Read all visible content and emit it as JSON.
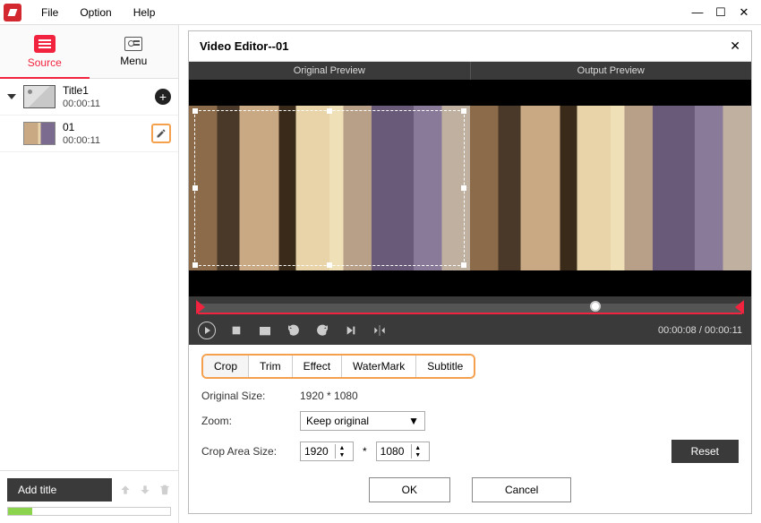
{
  "menubar": {
    "file": "File",
    "option": "Option",
    "help": "Help"
  },
  "sidebar": {
    "tabs": {
      "source": "Source",
      "menu": "Menu"
    },
    "items": [
      {
        "title": "Title1",
        "time": "00:00:11"
      },
      {
        "title": "01",
        "time": "00:00:11"
      }
    ],
    "add_title": "Add title"
  },
  "editor": {
    "title": "Video Editor--01",
    "preview_left": "Original Preview",
    "preview_right": "Output Preview",
    "timecode_current": "00:00:08",
    "timecode_total": "00:00:11",
    "tabs": {
      "crop": "Crop",
      "trim": "Trim",
      "effect": "Effect",
      "watermark": "WaterMark",
      "subtitle": "Subtitle"
    },
    "form": {
      "original_size_label": "Original Size:",
      "original_size_value": "1920 * 1080",
      "zoom_label": "Zoom:",
      "zoom_value": "Keep original",
      "crop_area_label": "Crop Area Size:",
      "crop_w": "1920",
      "crop_h": "1080",
      "times": "*",
      "reset": "Reset"
    },
    "buttons": {
      "ok": "OK",
      "cancel": "Cancel"
    }
  }
}
